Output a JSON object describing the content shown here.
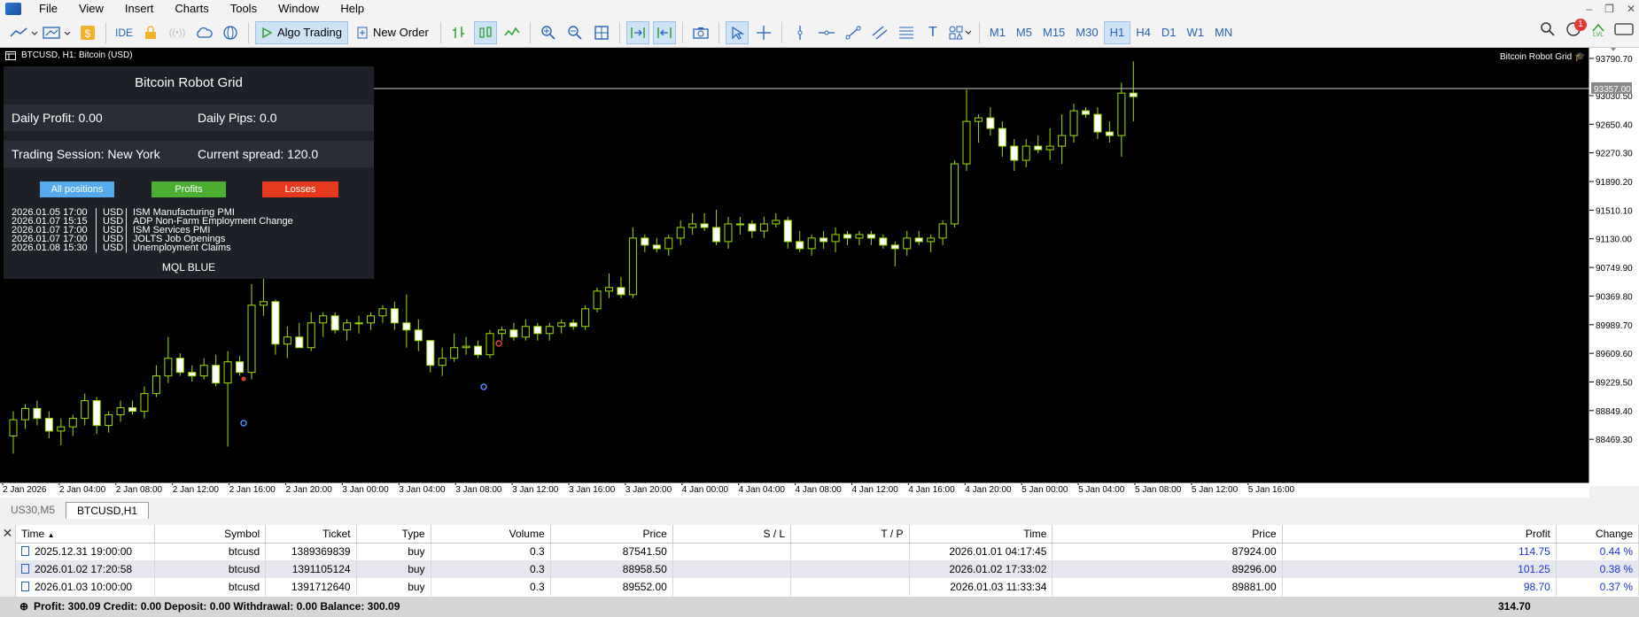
{
  "menu": [
    "File",
    "View",
    "Insert",
    "Charts",
    "Tools",
    "Window",
    "Help"
  ],
  "toolbar": {
    "ide_label": "IDE",
    "algo_label": "Algo Trading",
    "new_order_label": "New Order",
    "timeframes": [
      "M1",
      "M5",
      "M15",
      "M30",
      "H1",
      "H4",
      "D1",
      "W1",
      "MN"
    ],
    "active_timeframe": "H1",
    "notification_count": "1",
    "lvl_label": "LVL"
  },
  "chart": {
    "header": "BTCUSD, H1:  Bitcoin (USD)",
    "ea_name": "Bitcoin Robot Grid",
    "current_price_label": "93357.00",
    "price_ticks": [
      "93790.70",
      "93030.50",
      "92650.40",
      "92270.30",
      "91890.20",
      "91510.10",
      "91130.00",
      "90749.90",
      "90369.80",
      "89989.70",
      "89609.60",
      "89229.50",
      "88849.40",
      "88469.30"
    ],
    "time_ticks": [
      "2 Jan 2026",
      "2 Jan 04:00",
      "2 Jan 08:00",
      "2 Jan 12:00",
      "2 Jan 16:00",
      "2 Jan 20:00",
      "3 Jan 00:00",
      "3 Jan 04:00",
      "3 Jan 08:00",
      "3 Jan 12:00",
      "3 Jan 16:00",
      "3 Jan 20:00",
      "4 Jan 00:00",
      "4 Jan 04:00",
      "4 Jan 08:00",
      "4 Jan 12:00",
      "4 Jan 16:00",
      "4 Jan 20:00",
      "5 Jan 00:00",
      "5 Jan 04:00",
      "5 Jan 08:00",
      "5 Jan 12:00",
      "5 Jan 16:00"
    ],
    "colors": {
      "bull": "#000000",
      "bear": "#ffffff",
      "wick": "#9be000",
      "grid_line": "#cfcfcf"
    }
  },
  "panel": {
    "title": "Bitcoin Robot Grid",
    "daily_profit": "Daily Profit: 0.00",
    "daily_pips": "Daily Pips:  0.0",
    "session": "Trading Session: New York",
    "spread": "Current spread: 120.0",
    "buttons": [
      {
        "label": "All positions",
        "color": "#56a9ec"
      },
      {
        "label": "Profits",
        "color": "#4caf32"
      },
      {
        "label": "Losses",
        "color": "#e53a1e"
      }
    ],
    "news": [
      {
        "date": "2026.01.05 17:00",
        "cur": "USD",
        "event": "ISM Manufacturing PMI"
      },
      {
        "date": "2026.01.07 15:15",
        "cur": "USD",
        "event": "ADP Non-Farm Employment Change"
      },
      {
        "date": "2026.01.07 17:00",
        "cur": "USD",
        "event": "ISM Services PMI"
      },
      {
        "date": "2026.01.07 17:00",
        "cur": "USD",
        "event": "JOLTS Job Openings"
      },
      {
        "date": "2026.01.08 15:30",
        "cur": "USD",
        "event": "Unemployment Claims"
      }
    ],
    "footer": "MQL BLUE"
  },
  "tabs": [
    "US30,M5",
    "BTCUSD,H1"
  ],
  "grid": {
    "headers": [
      "Time",
      "Symbol",
      "Ticket",
      "Type",
      "Volume",
      "Price",
      "S / L",
      "T / P",
      "Time",
      "Price",
      "Profit",
      "Change"
    ],
    "rows": [
      [
        "2025.12.31 19:00:00",
        "btcusd",
        "1389369839",
        "buy",
        "0.3",
        "87541.50",
        "",
        "",
        "2026.01.01 04:17:45",
        "87924.00",
        "114.75",
        "0.44 %"
      ],
      [
        "2026.01.02 17:20:58",
        "btcusd",
        "1391105124",
        "buy",
        "0.3",
        "88958.50",
        "",
        "",
        "2026.01.02 17:33:02",
        "89296.00",
        "101.25",
        "0.38 %"
      ],
      [
        "2026.01.03 10:00:00",
        "btcusd",
        "1391712640",
        "buy",
        "0.3",
        "89552.00",
        "",
        "",
        "2026.01.03 11:33:34",
        "89881.00",
        "98.70",
        "0.37 %"
      ]
    ],
    "summary": "Profit: 300.09  Credit: 0.00  Deposit: 0.00  Withdrawal: 0.00  Balance: 300.09",
    "summary_total": "314.70"
  }
}
